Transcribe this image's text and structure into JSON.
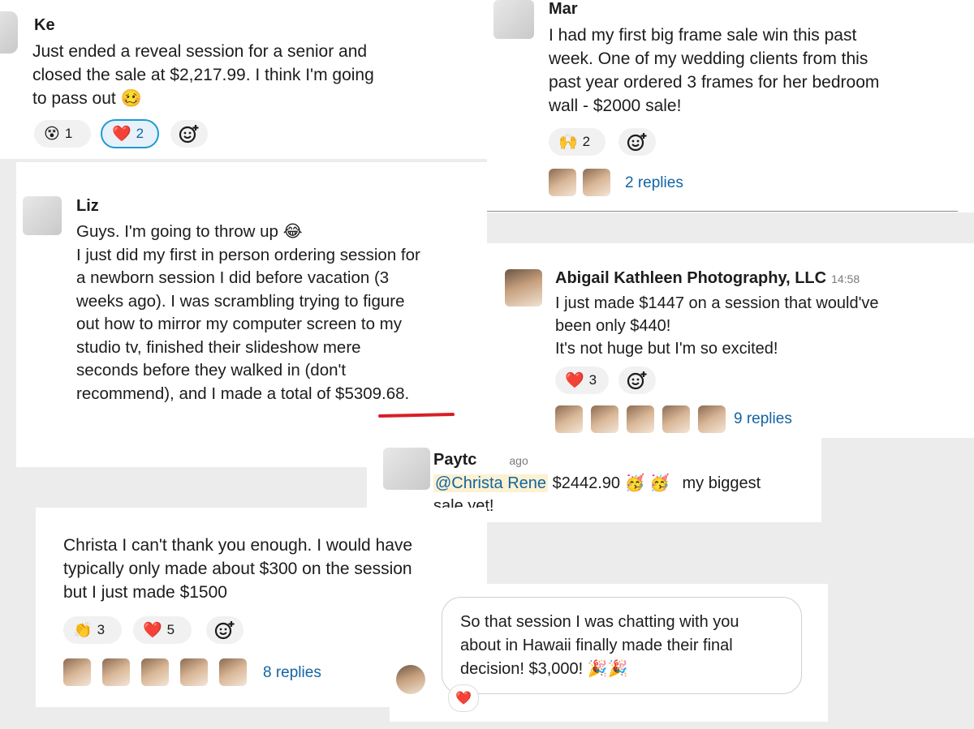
{
  "post1": {
    "author": "Ke",
    "text_lines": [
      "Just ended a reveal session for a senior and",
      "closed the sale at $2,217.99. I think I'm going",
      "to pass out 🥴"
    ],
    "reactions": [
      {
        "icon": "astonished-face",
        "glyph": "😵",
        "count": "1"
      },
      {
        "icon": "heart",
        "glyph": "❤️",
        "count": "2"
      }
    ]
  },
  "post2": {
    "author": "Mar",
    "text_lines": [
      "I had my first big frame sale win this past",
      "week. One of my wedding clients from this",
      "past year ordered 3 frames for her bedroom",
      "wall - $2000 sale!"
    ],
    "reactions": [
      {
        "icon": "raised-hands",
        "glyph": "🙌",
        "count": "2"
      }
    ],
    "replies": "2 replies"
  },
  "post3": {
    "author": "Liz",
    "text_lines": [
      "Guys. I'm going to throw up 😂",
      "I just did my first in person ordering session for",
      "a newborn session I did before vacation (3",
      "weeks ago). I was scrambling trying to figure",
      "out how to mirror my computer screen to my",
      "studio tv, finished their slideshow mere",
      "seconds before they walked in (don't",
      "recommend), and I made a total of $5309.68."
    ]
  },
  "post4": {
    "author": "Abigail Kathleen Photography, LLC",
    "time": "14:58",
    "text_lines": [
      "I just made $1447 on a session that would've",
      "been only $440!",
      "It's not huge but I'm so excited!"
    ],
    "reactions": [
      {
        "icon": "heart",
        "glyph": "❤️",
        "count": "3"
      }
    ],
    "replies": "9 replies"
  },
  "post5": {
    "author": "Paytc",
    "time": "ago",
    "mention": "@Christa Rene",
    "amount": "$2442.90",
    "emoji": "🥳",
    "suffix": "my biggest",
    "line2": "sale yet!"
  },
  "post6": {
    "text_lines": [
      "Christa I can't thank you enough. I would have",
      "typically only made about $300 on the session",
      "but I just made $1500"
    ],
    "reactions": [
      {
        "icon": "clapping-hands",
        "glyph": "👏",
        "count": "3"
      },
      {
        "icon": "heart",
        "glyph": "❤️",
        "count": "5"
      }
    ],
    "replies": "8 replies"
  },
  "post7": {
    "text_lines": [
      "So that session I was chatting with you",
      "about in Hawaii finally made their final",
      "decision! $3,000! 🎉🎉"
    ],
    "reaction": "❤️"
  },
  "icons": {
    "add_reaction": "add-reaction-icon"
  }
}
